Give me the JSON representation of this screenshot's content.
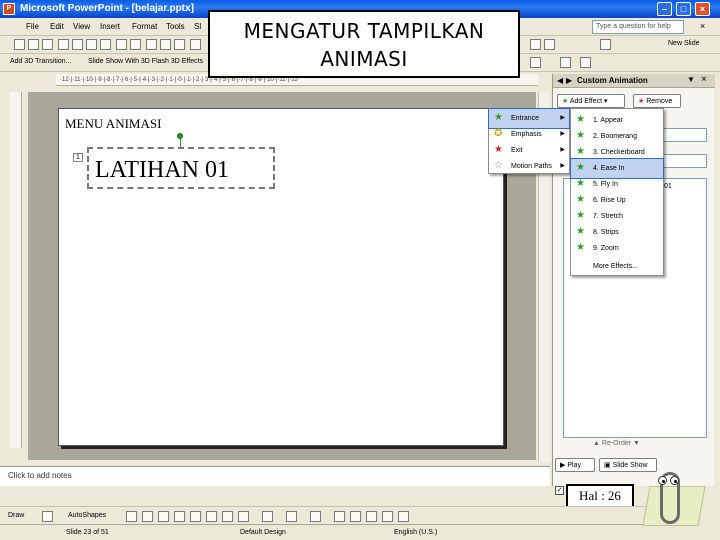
{
  "window": {
    "title": "Microsoft PowerPoint - [belajar.pptx]",
    "app_icon_glyph": "P"
  },
  "menu": {
    "items": [
      "File",
      "Edit",
      "View",
      "Insert",
      "Format",
      "Tools",
      "Sl"
    ],
    "help_placeholder": "Type a question for help"
  },
  "toolbar": {
    "transition_label": "Add 3D Transition...",
    "slideshow_label": "Slide Show With 3D Flash 3D Effects",
    "new_slide_label": "New Slide"
  },
  "overlay": {
    "line1": "MENGATUR TAMPILKAN",
    "line2": "ANIMASI"
  },
  "slide": {
    "heading": "MENU ANIMASI",
    "anim_tag": "1",
    "textbox_text": "LATIHAN 01"
  },
  "notes": {
    "placeholder": "Click to add notes"
  },
  "taskpane": {
    "title": "Custom Animation",
    "add_effect": "Add Effect",
    "remove": "Remove",
    "list_item": "01",
    "reorder": "Re-Order",
    "play": "Play",
    "slideshow": "Slide Show"
  },
  "effects_menu": {
    "items": [
      {
        "label": "Entrance",
        "icon": "entrance-star-icon"
      },
      {
        "label": "Emphasis",
        "icon": "emphasis-star-icon"
      },
      {
        "label": "Exit",
        "icon": "exit-star-icon"
      },
      {
        "label": "Motion Paths",
        "icon": "motion-path-star-icon"
      }
    ]
  },
  "entrance_menu": {
    "items": [
      "1. Appear",
      "2. Boomerang",
      "3. Checkerboard",
      "4. Ease In",
      "5. Fly In",
      "6. Rise Up",
      "7. Stretch",
      "8. Strips",
      "9. Zoom",
      "More Effects..."
    ],
    "highlighted_index": 3
  },
  "page_label": "Hal : 26",
  "drawbar": {
    "draw": "Draw",
    "autoshapes": "AutoShapes"
  },
  "status": {
    "slide": "Slide 23 of 51",
    "design": "Default Design",
    "language": "English (U.S.)"
  },
  "colors": {
    "titlebar": "#0a5ce6",
    "highlight": "#c1d2ee",
    "entrance_icon": "#2a9b2a",
    "exit_icon": "#c83232"
  }
}
